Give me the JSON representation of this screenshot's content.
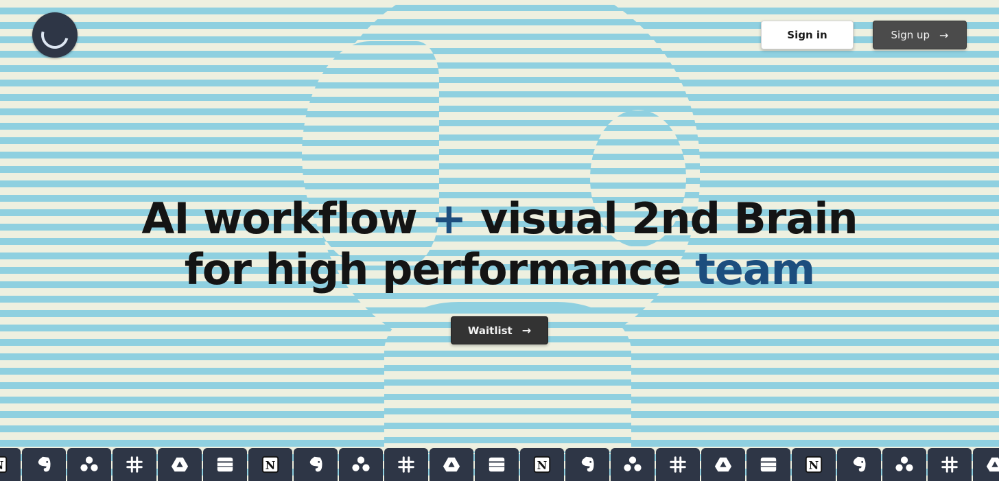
{
  "header": {
    "logo_icon": "brain-circle-logo",
    "signin_label": "Sign in",
    "signup_label": "Sign up",
    "signup_icon": "arrow-right-icon"
  },
  "hero": {
    "line1_part1": "AI workflow",
    "line1_plus": "+",
    "line1_part2": "visual 2nd Brain",
    "line2_part1": "for high performance",
    "line2_accent": "team",
    "accent_color": "#1d4e7e",
    "waitlist_label": "Waitlist",
    "waitlist_icon": "arrow-right-icon"
  },
  "integrations": [
    "notion-icon",
    "evernote-icon",
    "asana-icon",
    "slack-icon",
    "google-drive-icon",
    "stack-icon",
    "notion-icon",
    "evernote-icon",
    "asana-icon",
    "slack-icon",
    "google-drive-icon",
    "stack-icon",
    "notion-icon",
    "evernote-icon",
    "asana-icon",
    "slack-icon",
    "google-drive-icon",
    "stack-icon",
    "notion-icon",
    "evernote-icon",
    "asana-icon",
    "slack-icon",
    "google-drive-icon"
  ],
  "colors": {
    "stripe_light": "#eef0e0",
    "stripe_blue": "#8fd0e0",
    "tile_bg": "#2e3646"
  }
}
